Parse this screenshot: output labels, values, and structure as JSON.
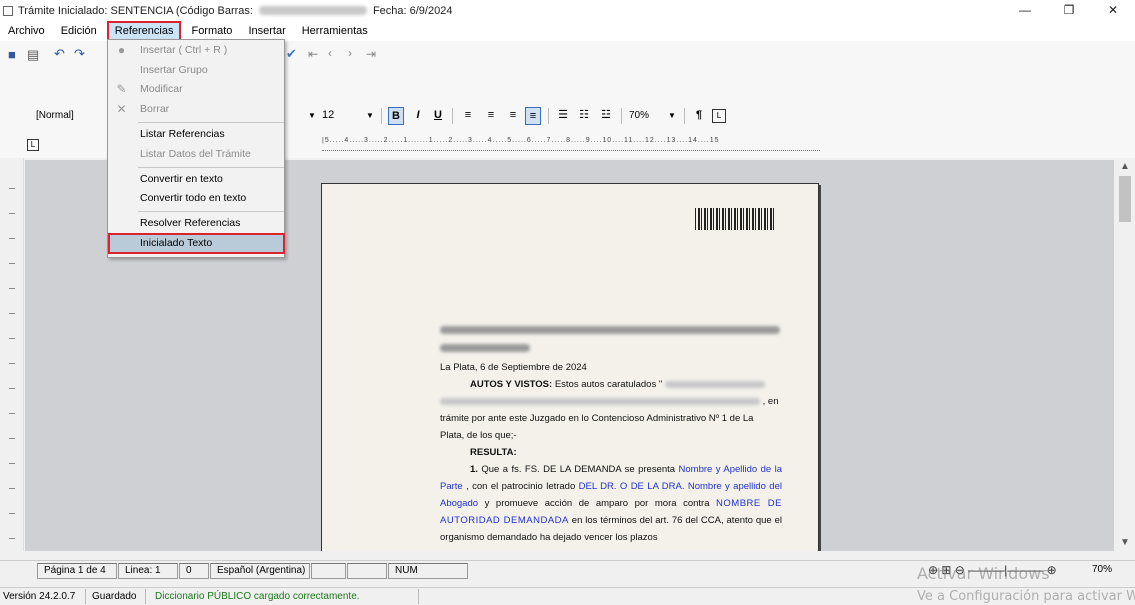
{
  "window": {
    "title_prefix": "Trámite Inicialado: SENTENCIA (Código Barras:",
    "title_suffix": "Fecha: 6/9/2024",
    "btn_min": "—",
    "btn_max": "❐",
    "btn_close": "✕"
  },
  "menu": [
    "Archivo",
    "Edición",
    "Referencias",
    "Formato",
    "Insertar",
    "Herramientas"
  ],
  "dropdown": {
    "items": [
      {
        "label": "Insertar ( Ctrl + R )",
        "icon": "●"
      },
      {
        "label": "Insertar Grupo",
        "icon": ""
      },
      {
        "label": "Modificar",
        "icon": "✎"
      },
      {
        "label": "Borrar",
        "icon": "✕"
      },
      {
        "label": "Listar Referencias",
        "icon": ""
      },
      {
        "label": "Listar Datos del Trámite",
        "icon": ""
      },
      {
        "label": "Convertir en texto",
        "icon": ""
      },
      {
        "label": "Convertir todo en texto",
        "icon": ""
      },
      {
        "label": "Resolver Referencias",
        "icon": ""
      },
      {
        "label": "Inicialado Texto",
        "icon": ""
      }
    ]
  },
  "format_bar": {
    "style": "[Normal]",
    "font_size": "12",
    "bold": "B",
    "italic": "I",
    "underline": "U",
    "zoom": "70%",
    "pilcrow": "¶"
  },
  "ruler": {
    "marks": "|5.....4.....3.....2.....1.......1.....2.....3.....4.....5.....6.....7.....8.....9....10....11....12....13....14....15"
  },
  "document": {
    "place_date": "La Plata, 6 de Septiembre de 2024",
    "autos_label": "AUTOS Y VISTOS:",
    "autos_text": "Estos autos caratulados \"",
    "line3_end": ", en",
    "line4": "trámite por ante este Juzgado en lo Contencioso Administrativo Nº 1 de La",
    "line5": "Plata, de los que;-",
    "resulta": "RESULTA:",
    "p1_num": "1.",
    "p1_a": "Que a fs. FS. DE LA DEMANDA se presenta",
    "p1_name1": "Nombre y Apellido de",
    "p1_name2": "la Parte",
    "p1_b": ", con el patrocinio letrado",
    "p1_name3": "DEL DR. O DE LA DRA. Nombre y",
    "p1_name4": "apellido del Abogado",
    "p1_c": "y promueve acción de amparo por mora contra",
    "p1_name5": "NOMBRE DE AUTORIDAD DEMANDADA",
    "p1_d": "en los términos del art. 76 del",
    "p1_e": "CCA, atento que el organismo demandado ha dejado vencer los plazos"
  },
  "status": {
    "page": "Página 1 de 4",
    "line": "Linea: 1",
    "col": "0",
    "lang": "Español (Argentina)",
    "num": "NUM",
    "zoom": "70%"
  },
  "bottom": {
    "version": "Versión 24.2.0.7",
    "saved": "Guardado",
    "dictionary": "Diccionario PÚBLICO cargado correctamente.",
    "watermark1": "Activar Windows",
    "watermark2": "Ve a Configuración para activar W"
  }
}
